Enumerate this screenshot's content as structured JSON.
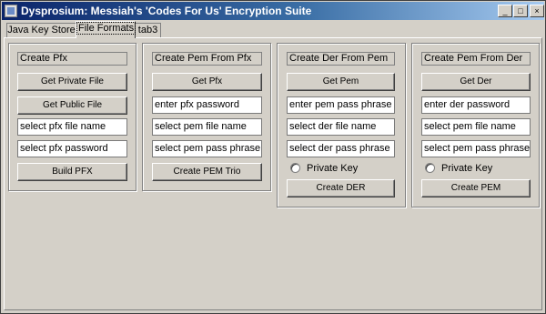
{
  "window": {
    "title": "Dysprosium: Messiah's 'Codes For Us' Encryption Suite",
    "controls": {
      "minimize": "_",
      "maximize": "□",
      "close": "×"
    }
  },
  "tabs": [
    {
      "label": "Java Key Store"
    },
    {
      "label": "File Formats",
      "selected": true
    },
    {
      "label": "tab3"
    }
  ],
  "groups": {
    "pfx": {
      "title": "Create Pfx",
      "get_private_file": "Get Private File",
      "get_public_file": "Get Public File",
      "file_name": "select pfx file name",
      "password": "select pfx password",
      "build": "Build PFX"
    },
    "pem_from_pfx": {
      "title": "Create Pem From Pfx",
      "get_pfx": "Get Pfx",
      "pfx_password": "enter pfx password",
      "pem_file_name": "select pem file name",
      "pem_pass_phrase": "select pem pass phrase",
      "create": "Create PEM Trio"
    },
    "der_from_pem": {
      "title": "Create Der From Pem",
      "get_pem": "Get Pem",
      "pem_pass_phrase": "enter pem pass phrase",
      "der_file_name": "select der file name",
      "der_pass_phrase": "select der pass phrase",
      "private_key": "Private Key",
      "create": "Create DER"
    },
    "pem_from_der": {
      "title": "Create Pem From Der",
      "get_der": "Get Der",
      "der_password": "enter der password",
      "pem_file_name": "select pem file name",
      "pem_pass_phrase": "select pem pass phrase",
      "private_key": "Private Key",
      "create": "Create PEM"
    }
  },
  "colors": {
    "face": "#d4d0c8",
    "titlebar_start": "#0a246a",
    "titlebar_end": "#a6caf0"
  }
}
